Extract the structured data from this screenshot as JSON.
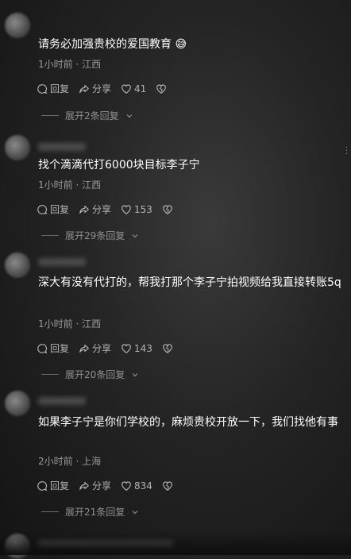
{
  "comments": [
    {
      "text": "请务必加强贵校的爱国教育 😅",
      "meta": "1小时前 · 江西",
      "reply_label": "回复",
      "share_label": "分享",
      "likes": "41",
      "expand_label": "展开2条回复"
    },
    {
      "text": "找个滴滴代打6000块目标李子宁",
      "meta": "1小时前 · 江西",
      "reply_label": "回复",
      "share_label": "分享",
      "likes": "153",
      "expand_label": "展开29条回复"
    },
    {
      "text": "深大有没有代打的，帮我打那个李子宁拍视频给我直接转账5q",
      "meta": "1小时前 · 江西",
      "reply_label": "回复",
      "share_label": "分享",
      "likes": "143",
      "expand_label": "展开20条回复"
    },
    {
      "text": "如果李子宁是你们学校的，麻烦贵校开放一下，我们找他有事",
      "meta": "2小时前 · 上海",
      "reply_label": "回复",
      "share_label": "分享",
      "likes": "834",
      "expand_label": "展开21条回复"
    }
  ],
  "icons": {
    "reply": "reply-icon",
    "share": "share-icon",
    "like": "heart-icon",
    "dislike": "dislike-icon",
    "expand": "chevron-down-icon",
    "more": "more-vertical-icon"
  }
}
